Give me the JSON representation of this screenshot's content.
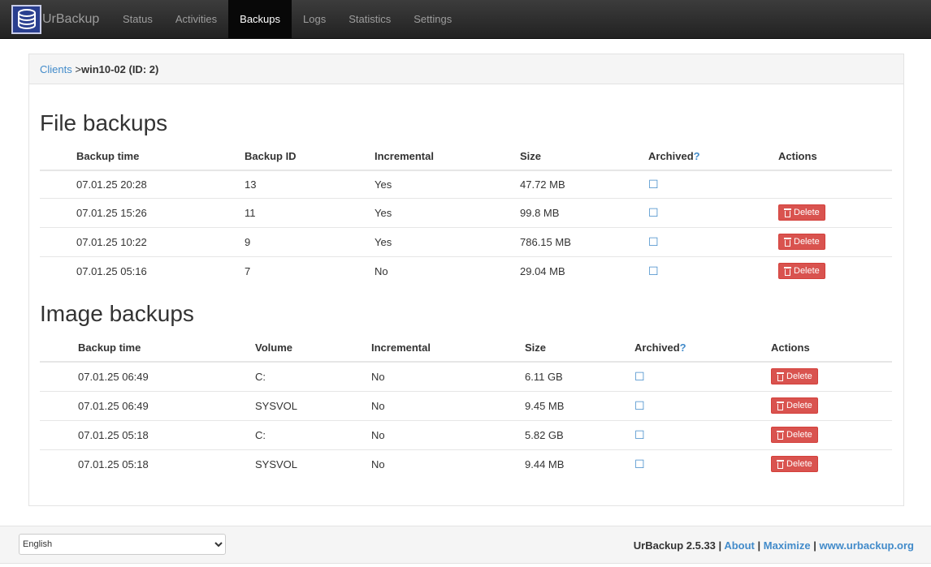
{
  "nav": {
    "brand": "UrBackup",
    "items": [
      {
        "label": "Status"
      },
      {
        "label": "Activities"
      },
      {
        "label": "Backups",
        "active": true
      },
      {
        "label": "Logs"
      },
      {
        "label": "Statistics"
      },
      {
        "label": "Settings"
      }
    ]
  },
  "breadcrumb": {
    "link": "Clients",
    "separator": ">",
    "current": "win10-02 (ID: 2)"
  },
  "file_backups": {
    "title": "File backups",
    "headers": {
      "time": "Backup time",
      "id": "Backup ID",
      "incremental": "Incremental",
      "size": "Size",
      "archived": "Archived",
      "help": "?",
      "actions": "Actions"
    },
    "rows": [
      {
        "time": "07.01.25 20:28",
        "id": "13",
        "incremental": "Yes",
        "size": "47.72 MB",
        "archived": "☐",
        "delete": ""
      },
      {
        "time": "07.01.25 15:26",
        "id": "11",
        "incremental": "Yes",
        "size": "99.8 MB",
        "archived": "☐",
        "delete": "Delete"
      },
      {
        "time": "07.01.25 10:22",
        "id": "9",
        "incremental": "Yes",
        "size": "786.15 MB",
        "archived": "☐",
        "delete": "Delete"
      },
      {
        "time": "07.01.25 05:16",
        "id": "7",
        "incremental": "No",
        "size": "29.04 MB",
        "archived": "☐",
        "delete": "Delete"
      }
    ]
  },
  "image_backups": {
    "title": "Image backups",
    "headers": {
      "time": "Backup time",
      "volume": "Volume",
      "incremental": "Incremental",
      "size": "Size",
      "archived": "Archived",
      "help": "?",
      "actions": "Actions"
    },
    "rows": [
      {
        "time": "07.01.25 06:49",
        "volume": "C:",
        "incremental": "No",
        "size": "6.11 GB",
        "archived": "☐",
        "delete": "Delete"
      },
      {
        "time": "07.01.25 06:49",
        "volume": "SYSVOL",
        "incremental": "No",
        "size": "9.45 MB",
        "archived": "☐",
        "delete": "Delete"
      },
      {
        "time": "07.01.25 05:18",
        "volume": "C:",
        "incremental": "No",
        "size": "5.82 GB",
        "archived": "☐",
        "delete": "Delete"
      },
      {
        "time": "07.01.25 05:18",
        "volume": "SYSVOL",
        "incremental": "No",
        "size": "9.44 MB",
        "archived": "☐",
        "delete": "Delete"
      }
    ]
  },
  "footer": {
    "language": "English",
    "version": "UrBackup 2.5.33",
    "sep": "|",
    "about": "About",
    "maximize": "Maximize",
    "website": "www.urbackup.org"
  },
  "colors": {
    "link": "#428bca",
    "danger": "#d9534f",
    "navbar": "#222222"
  }
}
